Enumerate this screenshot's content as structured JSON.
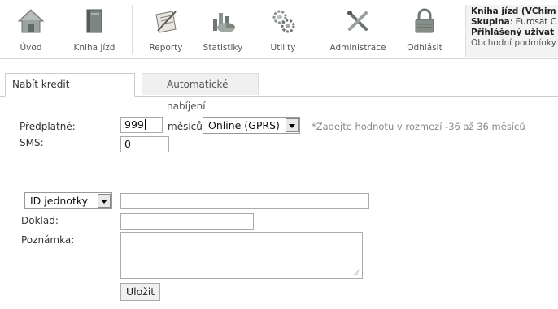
{
  "nav": {
    "items": [
      {
        "label": "Úvod",
        "icon": "home-icon"
      },
      {
        "label": "Kniha jízd",
        "icon": "book-icon"
      },
      {
        "label": "Reporty",
        "icon": "report-icon"
      },
      {
        "label": "Statistiky",
        "icon": "statistics-icon"
      },
      {
        "label": "Utility",
        "icon": "gears-icon"
      },
      {
        "label": "Administrace",
        "icon": "tools-icon"
      },
      {
        "label": "Odhlásit",
        "icon": "lock-icon"
      }
    ]
  },
  "info": {
    "app_title": "Kniha jízd (VChim",
    "group_label": "Skupina",
    "group_value": ": Eurosat C",
    "user_label": "Přihlášený uživat",
    "terms_link": "Obchodní podmínky"
  },
  "tabs": {
    "active": "Nabít kredit",
    "inactive": "Automatické nabíjení"
  },
  "form": {
    "subscription_label": "Předplatné:",
    "subscription_value": "999",
    "months_label": "měsíců",
    "mode_select": "Online (GPRS)",
    "hint": "*Zadejte hodnotu v rozmezí -36 až 36 měsíců",
    "sms_label": "SMS:",
    "sms_value": "0",
    "id_select": "ID jednotky",
    "id_value": "",
    "document_label": "Doklad:",
    "document_value": "",
    "note_label": "Poznámka:",
    "note_value": "",
    "save_label": "Uložit"
  }
}
